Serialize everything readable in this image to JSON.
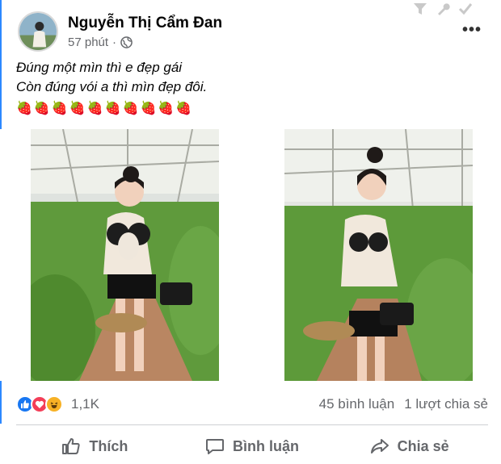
{
  "post": {
    "author": "Nguyễn Thị Cẩm Đan",
    "time": "57 phút",
    "dot": "·",
    "caption_line1": "Đúng một mìn thì e đẹp gái",
    "caption_line2": "Còn đúng vói a thì mìn đẹp đôi.",
    "emoji_line": "🍓🍓🍓🍓🍓🍓🍓🍓🍓🍓"
  },
  "stats": {
    "reaction_count": "1,1K",
    "comments": "45 bình luận",
    "shares": "1 lượt chia sẻ"
  },
  "actions": {
    "like": "Thích",
    "comment": "Bình luận",
    "share": "Chia sẻ"
  },
  "colors": {
    "accent": "#2d88ff",
    "text_secondary": "#65676b",
    "like_blue": "#1877f2",
    "love_red": "#f33e58",
    "haha_yellow": "#f7b125"
  },
  "icons": [
    "filter-icon",
    "wrench-icon",
    "check-icon",
    "globe-icon",
    "more-icon",
    "like-reaction-icon",
    "love-reaction-icon",
    "haha-reaction-icon",
    "thumbs-up-icon",
    "comment-icon",
    "share-icon"
  ]
}
